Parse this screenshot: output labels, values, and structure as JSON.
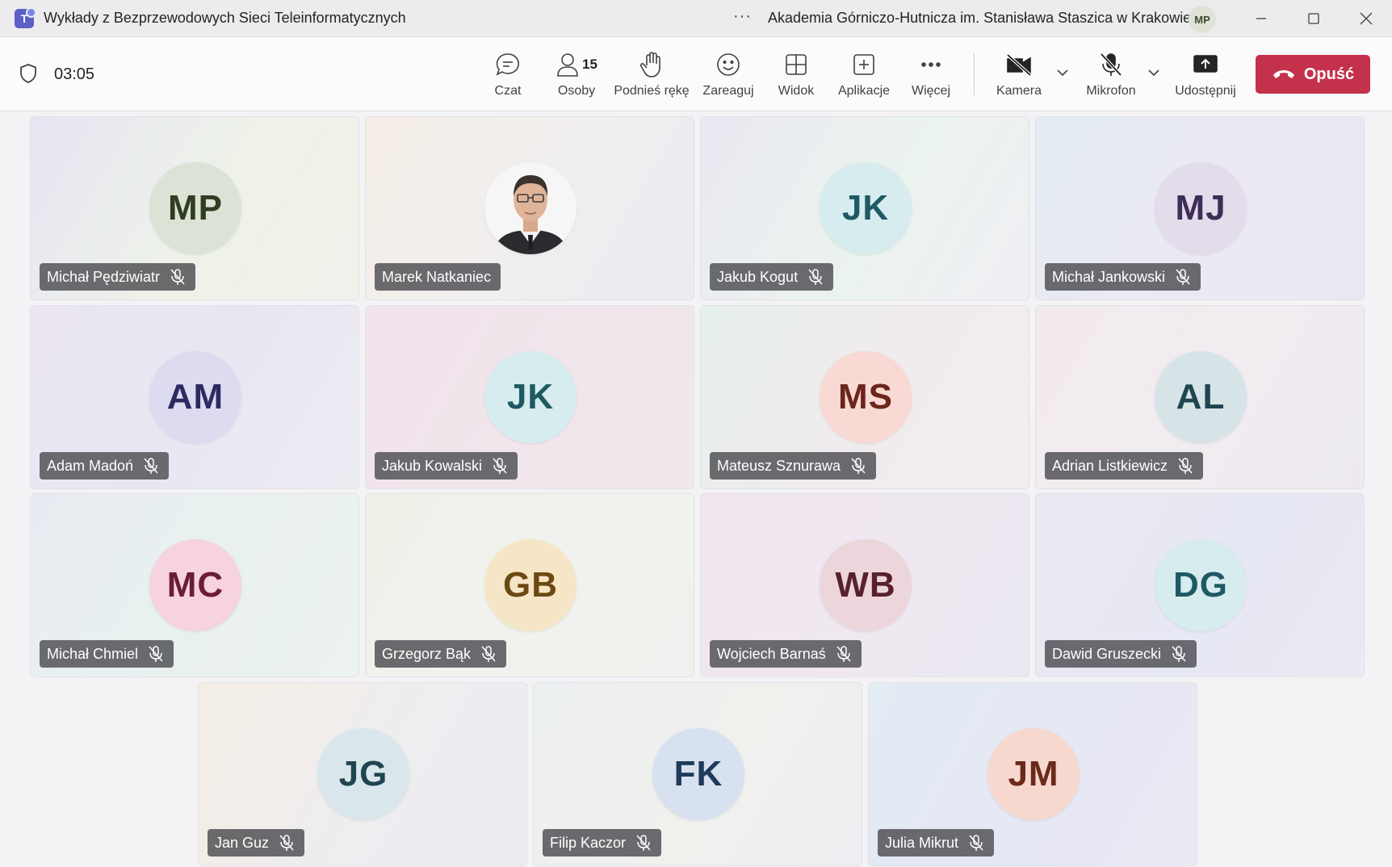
{
  "window": {
    "app_icon": "teams-logo",
    "title": "Wykłady z Bezprzewodowych Sieci Teleinformatycznych",
    "more": "···",
    "organization": "Akademia Górniczo-Hutnicza im. Stanisława Staszica w Krakowie",
    "user_initials": "MP"
  },
  "meeting": {
    "timer": "03:05",
    "tools": {
      "chat": "Czat",
      "people": "Osoby",
      "people_count": "15",
      "raise_hand": "Podnieś rękę",
      "react": "Zareaguj",
      "view": "Widok",
      "apps": "Aplikacje",
      "more": "Więcej",
      "camera": "Kamera",
      "mic": "Mikrofon",
      "share": "Udostępnij"
    },
    "leave_label": "Opuść"
  },
  "participants": [
    {
      "name": "Michał Pędziwiatr",
      "initials": "MP",
      "color": "#dde2d6",
      "text": "#2f3d22",
      "muted": true
    },
    {
      "name": "Marek Natkaniec",
      "initials": "",
      "photo": true,
      "muted": false
    },
    {
      "name": "Jakub Kogut",
      "initials": "JK",
      "color": "#d6ecef",
      "text": "#1f5a63",
      "muted": true
    },
    {
      "name": "Michał Jankowski",
      "initials": "MJ",
      "color": "#e2dceb",
      "text": "#3d2d57",
      "muted": true
    },
    {
      "name": "Adam Madoń",
      "initials": "AM",
      "color": "#dddbef",
      "text": "#2b2a63",
      "muted": true
    },
    {
      "name": "Jakub Kowalski",
      "initials": "JK",
      "color": "#d6ecef",
      "text": "#1f5a63",
      "muted": true
    },
    {
      "name": "Mateusz Sznurawa",
      "initials": "MS",
      "color": "#f8d9d3",
      "text": "#6b261c",
      "muted": true
    },
    {
      "name": "Adrian Listkiewicz",
      "initials": "AL",
      "color": "#d7e4e7",
      "text": "#1f4650",
      "muted": true
    },
    {
      "name": "Michał Chmiel",
      "initials": "MC",
      "color": "#f6d3de",
      "text": "#6a1c39",
      "muted": true
    },
    {
      "name": "Grzegorz Bąk",
      "initials": "GB",
      "color": "#f6e6c7",
      "text": "#6b4a12",
      "muted": true
    },
    {
      "name": "Wojciech Barnaś",
      "initials": "WB",
      "color": "#ecd6dc",
      "text": "#58202e",
      "muted": true
    },
    {
      "name": "Dawid Gruszecki",
      "initials": "DG",
      "color": "#d6ecef",
      "text": "#1f5a63",
      "muted": true
    },
    {
      "name": "Jan Guz",
      "initials": "JG",
      "color": "#d9e7ec",
      "text": "#1f4650",
      "muted": true
    },
    {
      "name": "Filip Kaczor",
      "initials": "FK",
      "color": "#d7e1ef",
      "text": "#1f3a5a",
      "muted": true
    },
    {
      "name": "Julia Mikrut",
      "initials": "JM",
      "color": "#f7d8cf",
      "text": "#6b2a1a",
      "muted": true
    }
  ]
}
